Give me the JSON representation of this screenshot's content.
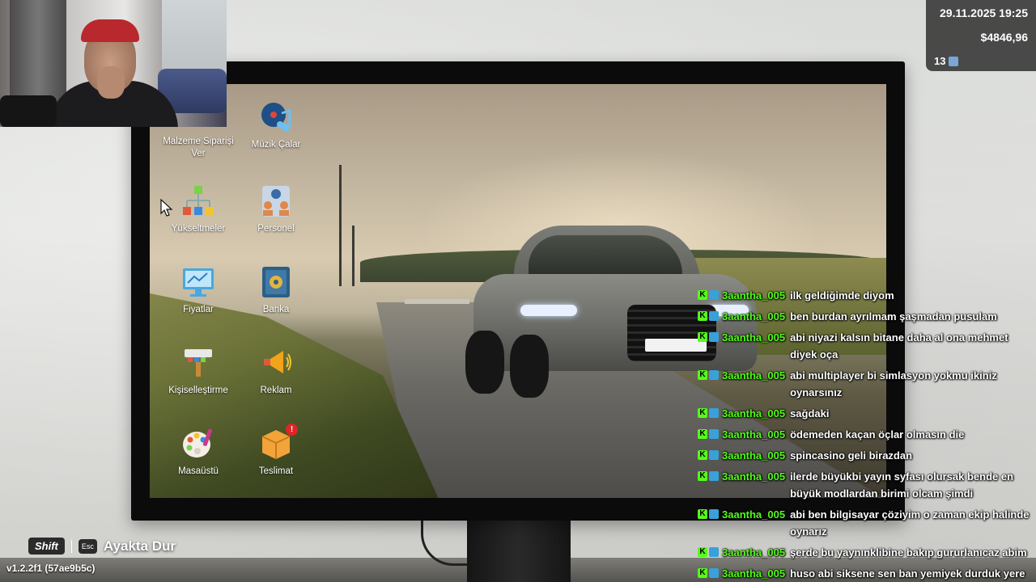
{
  "hud": {
    "date": "29.11.2025 19:25",
    "money": "$4846,96",
    "level": "13"
  },
  "desktop": {
    "icons": [
      {
        "label": "Malzeme Siparişi Ver",
        "icon": "box-order-icon"
      },
      {
        "label": "Müzik Çalar",
        "icon": "music-player-icon"
      },
      {
        "label": "Yükseltmeler",
        "icon": "upgrades-icon"
      },
      {
        "label": "Personel",
        "icon": "staff-icon"
      },
      {
        "label": "Fiyatlar",
        "icon": "prices-icon"
      },
      {
        "label": "Banka",
        "icon": "bank-icon"
      },
      {
        "label": "Kişiselleştirme",
        "icon": "customize-icon"
      },
      {
        "label": "Reklam",
        "icon": "megaphone-icon"
      },
      {
        "label": "Masaüstü",
        "icon": "palette-icon"
      },
      {
        "label": "Teslimat",
        "icon": "delivery-icon"
      }
    ],
    "delivery_badge": "!"
  },
  "chat": {
    "messages": [
      {
        "user": "3aantha_005",
        "text": "ilk geldiğimde diyom"
      },
      {
        "user": "3aantha_005",
        "text": "ben burdan ayrılmam şaşmadan pusulam"
      },
      {
        "user": "3aantha_005",
        "text": "abi niyazi kalsın bitane daha al ona mehmet diyek oça"
      },
      {
        "user": "3aantha_005",
        "text": "abi multiplayer bi simlasyon yokmu ikiniz oynarsınız"
      },
      {
        "user": "3aantha_005",
        "text": "sağdaki"
      },
      {
        "user": "3aantha_005",
        "text": "ödemeden kaçan öçlar olmasın die"
      },
      {
        "user": "3aantha_005",
        "text": "spincasino geli birazdan"
      },
      {
        "user": "3aantha_005",
        "text": "ilerde büyükbi yayın syfası olursak bende en büyük modlardan birimi olcam şimdi"
      },
      {
        "user": "3aantha_005",
        "text": "abi ben bilgisayar çöziyim o zaman ekip halinde oynarız"
      },
      {
        "user": "3aantha_005",
        "text": "şerde bu yaynınklibine bakıp gururlanıcaz abim"
      },
      {
        "user": "3aantha_005",
        "text": "huso abi siksene sen ban yemiyek durduk yere"
      }
    ]
  },
  "hints": {
    "shift_key": "Shift",
    "esc_key": "Esc",
    "action": "Ayakta Dur"
  },
  "version": "v1.2.2f1 (57ae9b5c)",
  "colors": {
    "chat_user": "#53fc18",
    "badge_red": "#e02525"
  }
}
